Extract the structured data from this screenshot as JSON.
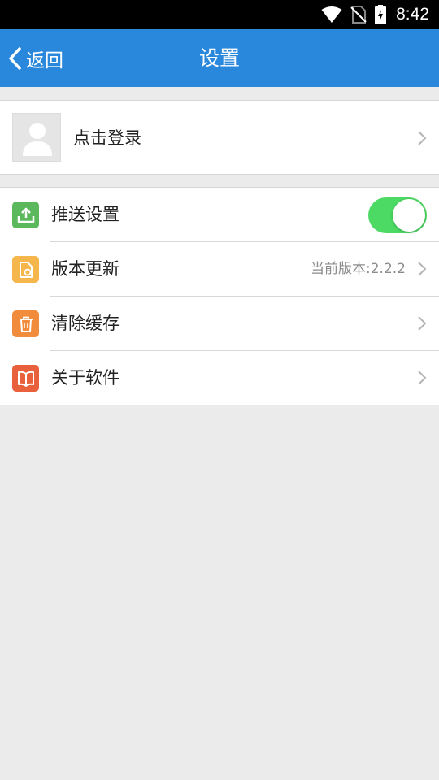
{
  "status_bar": {
    "time": "8:42"
  },
  "app_bar": {
    "back_label": "返回",
    "title": "设置"
  },
  "login": {
    "label": "点击登录"
  },
  "settings": {
    "items": [
      {
        "label": "推送设置",
        "icon": "push-upload-icon",
        "icon_color": "#5cb85c",
        "control": "toggle",
        "toggle_on": true
      },
      {
        "label": "版本更新",
        "icon": "document-update-icon",
        "icon_color": "#f5b64b",
        "value": "当前版本:2.2.2"
      },
      {
        "label": "清除缓存",
        "icon": "trash-icon",
        "icon_color": "#f08c3c"
      },
      {
        "label": "关于软件",
        "icon": "book-icon",
        "icon_color": "#e8613c"
      }
    ]
  },
  "colors": {
    "app_bar": "#2a88dc",
    "toggle_on": "#4cd964",
    "background": "#ebebeb"
  }
}
